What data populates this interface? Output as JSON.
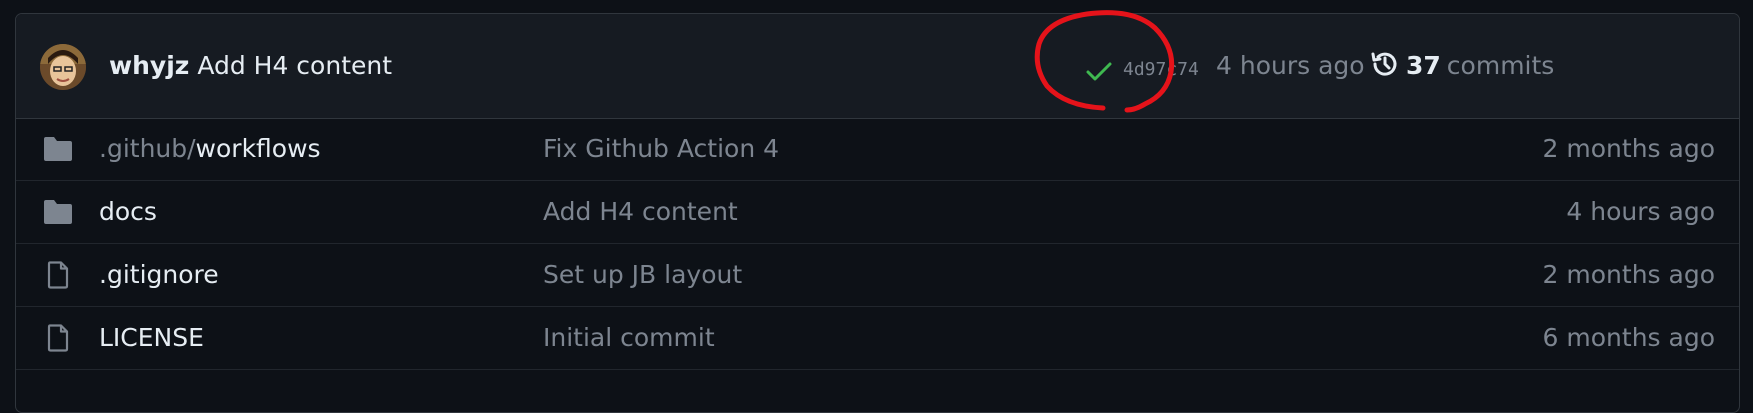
{
  "latest_commit": {
    "author": "whyjz",
    "message": "Add H4 content",
    "status_icon": "check-icon",
    "sha": "4d97c74",
    "time": "4 hours ago",
    "commits_count": "37",
    "commits_label": "commits"
  },
  "files": [
    {
      "type": "folder",
      "name_prefix": ".github/",
      "name": "workflows",
      "message": "Fix Github Action 4",
      "time": "2 months ago"
    },
    {
      "type": "folder",
      "name_prefix": "",
      "name": "docs",
      "message": "Add H4 content",
      "time": "4 hours ago"
    },
    {
      "type": "file",
      "name_prefix": "",
      "name": ".gitignore",
      "message": "Set up JB layout",
      "time": "2 months ago"
    },
    {
      "type": "file",
      "name_prefix": "",
      "name": "LICENSE",
      "message": "Initial commit",
      "time": "6 months ago"
    }
  ],
  "colors": {
    "background": "#0d1117",
    "header_bg": "#161b22",
    "text": "#e6edf3",
    "muted": "#7d8590",
    "success": "#3fb950",
    "annotation": "#e5131a"
  }
}
